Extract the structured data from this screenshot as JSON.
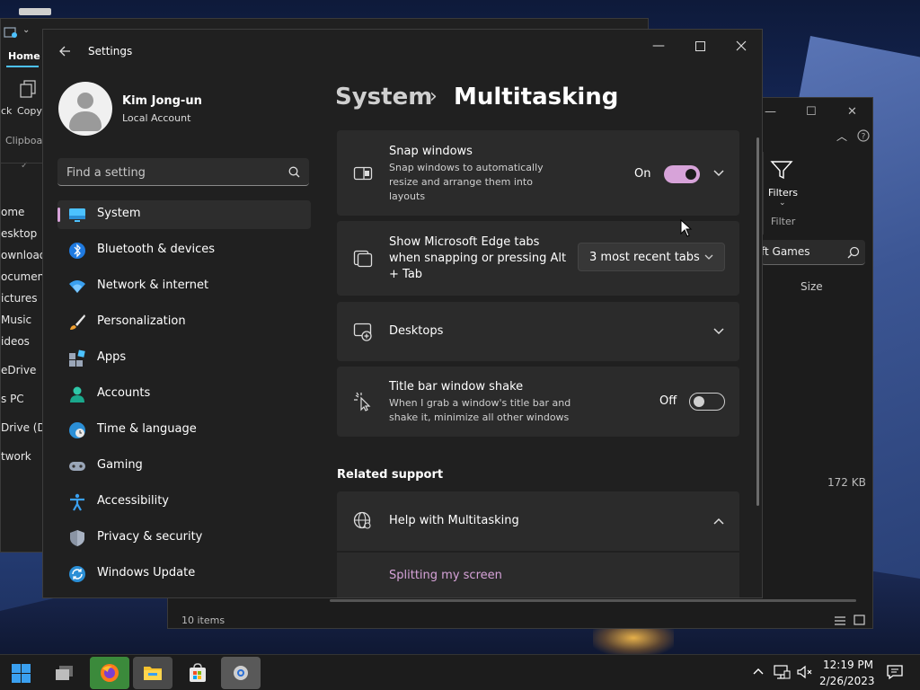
{
  "settings": {
    "app_title": "Settings",
    "profile": {
      "name": "Kim Jong-un",
      "account_type": "Local Account"
    },
    "search": {
      "placeholder": "Find a setting"
    },
    "nav": [
      {
        "label": "System",
        "icon": "system-icon",
        "active": true
      },
      {
        "label": "Bluetooth & devices",
        "icon": "bluetooth-icon"
      },
      {
        "label": "Network & internet",
        "icon": "wifi-icon"
      },
      {
        "label": "Personalization",
        "icon": "brush-icon"
      },
      {
        "label": "Apps",
        "icon": "apps-icon"
      },
      {
        "label": "Accounts",
        "icon": "person-icon"
      },
      {
        "label": "Time & language",
        "icon": "globe-clock-icon"
      },
      {
        "label": "Gaming",
        "icon": "gamepad-icon"
      },
      {
        "label": "Accessibility",
        "icon": "accessibility-icon"
      },
      {
        "label": "Privacy & security",
        "icon": "shield-icon"
      },
      {
        "label": "Windows Update",
        "icon": "update-icon"
      }
    ],
    "breadcrumb": {
      "parent": "System",
      "separator": "›",
      "current": "Multitasking"
    },
    "cards": {
      "snap": {
        "title": "Snap windows",
        "description": "Snap windows to automatically resize and arrange them into layouts",
        "state_label": "On",
        "enabled": true
      },
      "edge_tabs": {
        "title": "Show Microsoft Edge tabs when snapping or pressing Alt + Tab",
        "dropdown_value": "3 most recent tabs"
      },
      "desktops": {
        "title": "Desktops"
      },
      "shake": {
        "title": "Title bar window shake",
        "description": "When I grab a window's title bar and shake it, minimize all other windows",
        "state_label": "Off",
        "enabled": false
      }
    },
    "related": {
      "header": "Related support",
      "help_title": "Help with Multitasking",
      "link": "Splitting my screen"
    },
    "accent_color": "#d7a3d9"
  },
  "explorer_left": {
    "home_tab": "Home",
    "ribbon": {
      "cut_partial": "ck",
      "copy": "Copy",
      "clipboard_partial": "Clipboar"
    },
    "nav": [
      "ome",
      "esktop",
      "ownload",
      "ocument",
      "ictures",
      "Music",
      "ideos",
      "eDrive",
      "s PC",
      "Drive (D:",
      "twork"
    ]
  },
  "explorer_right": {
    "filters": "Filters",
    "filter_group": "Filter",
    "search_partial": "ft Games",
    "size_header": "Size",
    "size_value": "172 KB",
    "status": "10 items"
  },
  "taskbar": {
    "time": "12:19 PM",
    "date": "2/26/2023"
  }
}
